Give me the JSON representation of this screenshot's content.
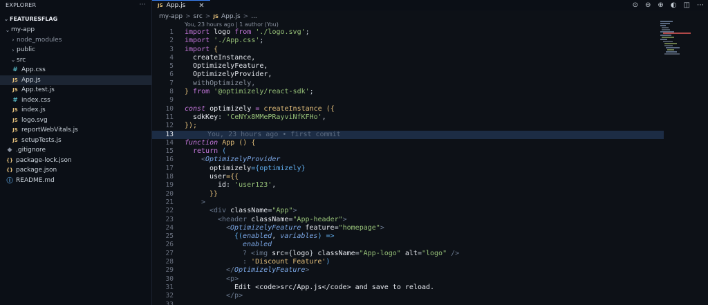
{
  "sidebar": {
    "title": "EXPLORER",
    "menu": "···",
    "project": "FEATURESFLAG",
    "items": [
      {
        "label": "my-app"
      },
      {
        "label": "node_modules"
      },
      {
        "label": "public"
      },
      {
        "label": "src"
      },
      {
        "label": "App.css",
        "icon": "#"
      },
      {
        "label": "App.js",
        "icon": "JS"
      },
      {
        "label": "App.test.js",
        "icon": "JS"
      },
      {
        "label": "index.css",
        "icon": "#"
      },
      {
        "label": "index.js",
        "icon": "JS"
      },
      {
        "label": "logo.svg",
        "icon": "JS"
      },
      {
        "label": "reportWebVitals.js",
        "icon": "JS"
      },
      {
        "label": "setupTests.js",
        "icon": "JS"
      },
      {
        "label": ".gitignore",
        "icon": "◆"
      },
      {
        "label": "package-lock.json",
        "icon": "{}"
      },
      {
        "label": "package.json",
        "icon": "{}"
      },
      {
        "label": "README.md",
        "icon": "ⓘ"
      }
    ]
  },
  "tab": {
    "icon": "JS",
    "label": "App.js",
    "close": "✕"
  },
  "breadcrumb": {
    "parts": [
      "my-app",
      "src",
      "App.js",
      "..."
    ],
    "icon": "JS",
    "sep": ">"
  },
  "blame": "You, 23 hours ago | 1 author (You)",
  "code": {
    "line_numbers": [
      "1",
      "2",
      "3",
      "4",
      "5",
      "6",
      "7",
      "8",
      "9",
      "10",
      "11",
      "12",
      "13",
      "14",
      "15",
      "16",
      "17",
      "18",
      "19",
      "20",
      "21",
      "22",
      "23",
      "24",
      "25",
      "26",
      "27",
      "28",
      "29",
      "30",
      "31",
      "32",
      "33"
    ],
    "l1": {
      "kw": "import",
      "a": " logo ",
      "kw2": "from",
      "s": " './logo.svg'",
      "p": ";"
    },
    "l2": {
      "kw": "import",
      "s": " './App.css'",
      "p": ";"
    },
    "l3": {
      "kw": "import",
      "p": " {"
    },
    "l4": "createInstance,",
    "l5": "OptimizelyFeature,",
    "l6": "OptimizelyProvider,",
    "l7": "withOptimizely,",
    "l8": {
      "p": "} ",
      "kw": "from",
      "s": " '@optimizely/react-sdk'",
      "p2": ";"
    },
    "l10": {
      "kw": "const",
      "v": " optimizely ",
      "op": "= ",
      "f": "createInstance",
      "p": " ({"
    },
    "l11": {
      "key": "sdkKey",
      "p": ": ",
      "s": "'CeNYx8MMePRayviNfKFHo'",
      "p2": ","
    },
    "l12": "});",
    "l13": "You, 23 hours ago • first commit",
    "l14": {
      "kw": "function",
      "f": " App",
      "p": " () {"
    },
    "l15": {
      "kw": "return",
      "p": " ("
    },
    "l16": {
      "p": "<",
      "t": "OptimizelyProvider"
    },
    "l17": {
      "a": "optimizely",
      "p": "={",
      "v": "optimizely",
      "p2": "}"
    },
    "l18": {
      "a": "user",
      "p": "={{"
    },
    "l19": {
      "key": "id",
      "p": ": ",
      "s": "'user123'",
      "p2": ","
    },
    "l20": "}}",
    "l21": ">",
    "l22": {
      "p": "<",
      "t": "div",
      "a": " className",
      "p2": "=",
      "s": "\"App\"",
      "p3": ">"
    },
    "l23": {
      "p": "<",
      "t": "header",
      "a": " className",
      "p2": "=",
      "s": "\"App-header\"",
      "p3": ">"
    },
    "l24": {
      "p": "<",
      "t": "OptimizelyFeature",
      "a": " feature",
      "p2": "=",
      "s": "\"homepage\"",
      "p3": ">"
    },
    "l25": {
      "p": "{(",
      "v": "enabled",
      "p2": ", ",
      "v2": "variables",
      "p3": ") =>"
    },
    "l26": "enabled",
    "l27": {
      "p": "? <",
      "t": "img",
      "a": " src",
      "p2": "={",
      "v": "logo",
      "p3": "} ",
      "a2": "className",
      "p4": "=",
      "s": "\"App-logo\"",
      "a3": " alt",
      "p5": "=",
      "s2": "\"logo\"",
      "p6": " />"
    },
    "l28": {
      "p": ": ",
      "s": "'Discount Feature'",
      "p2": ")"
    },
    "l29": {
      "p": "</",
      "t": "OptimizelyFeature",
      "p2": ">"
    },
    "l30": {
      "p": "<",
      "t": "p",
      "p2": ">"
    },
    "l31": {
      "pre": "Edit <",
      "t": "code",
      "p": ">src/App.js</",
      "t2": "code",
      "post": "> and save to reload."
    },
    "l32": {
      "p": "</",
      "t": "p",
      "p2": ">"
    }
  }
}
